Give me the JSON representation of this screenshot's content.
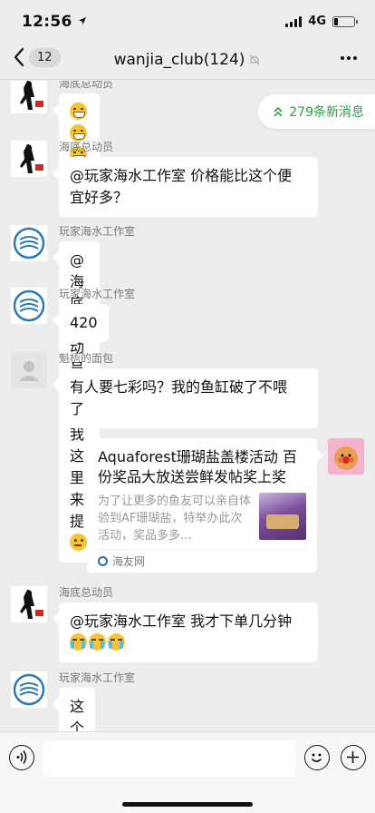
{
  "status_bar": {
    "time": "12:56",
    "network": "4G",
    "battery_level": 0.2
  },
  "nav": {
    "back_count": "12",
    "title": "wanjia_club(124)",
    "title_icon": "mute-icon",
    "more_icon": "more-icon"
  },
  "new_messages": {
    "label": "279条新消息",
    "icon": "double-chevron-up-icon",
    "color": "#2ba245"
  },
  "messages": [
    {
      "sender": "海底总动员",
      "text": "",
      "emojis": [
        "grin",
        "grin",
        "grin"
      ]
    },
    {
      "sender": "海底总动员",
      "text_line1": "@玩家海水工作室 价格能比这个便",
      "text_line2": "宜好多？"
    },
    {
      "sender": "玩家海水工作室",
      "text": "@海底总动员 下次我这里来提",
      "emoji": "think"
    },
    {
      "sender": "玩家海水工作室",
      "text": "420"
    },
    {
      "sender": "魁梧的面包",
      "text_line1": "有人要七彩吗？我的鱼缸破了不喂",
      "text_line2": "了"
    },
    {
      "type": "link",
      "title": "Aquaforest珊瑚盐盖楼活动 百份奖品大放送尝鲜发帖奖上奖",
      "description": "为了让更多的鱼友可以亲自体验到AF珊瑚盐，特举办此次活动，奖品多多...",
      "source": "海友网"
    },
    {
      "sender": "海底总动员",
      "text": "@玩家海水工作室 我才下单几分钟",
      "emojis": [
        "cry",
        "cry",
        "cry"
      ]
    },
    {
      "sender": "玩家海水工作室",
      "text": "这个你先买"
    }
  ],
  "input_bar": {
    "placeholder": "",
    "voice_icon": "voice-icon",
    "emoji_icon": "emoji-icon",
    "plus_icon": "plus-icon"
  }
}
